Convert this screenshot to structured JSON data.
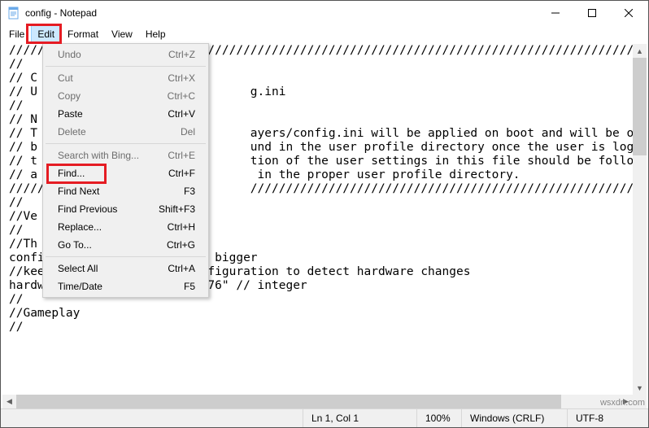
{
  "window": {
    "title": "config - Notepad",
    "min_icon": "minimize-icon",
    "max_icon": "maximize-icon",
    "close_icon": "close-icon"
  },
  "menubar": {
    "file": "File",
    "edit": "Edit",
    "format": "Format",
    "view": "View",
    "help": "Help"
  },
  "edit_menu": {
    "undo": {
      "label": "Undo",
      "shortcut": "Ctrl+Z"
    },
    "cut": {
      "label": "Cut",
      "shortcut": "Ctrl+X"
    },
    "copy": {
      "label": "Copy",
      "shortcut": "Ctrl+C"
    },
    "paste": {
      "label": "Paste",
      "shortcut": "Ctrl+V"
    },
    "delete": {
      "label": "Delete",
      "shortcut": "Del"
    },
    "bing": {
      "label": "Search with Bing...",
      "shortcut": "Ctrl+E"
    },
    "find": {
      "label": "Find...",
      "shortcut": "Ctrl+F"
    },
    "find_next": {
      "label": "Find Next",
      "shortcut": "F3"
    },
    "find_prev": {
      "label": "Find Previous",
      "shortcut": "Shift+F3"
    },
    "replace": {
      "label": "Replace...",
      "shortcut": "Ctrl+H"
    },
    "goto": {
      "label": "Go To...",
      "shortcut": "Ctrl+G"
    },
    "select_all": {
      "label": "Select All",
      "shortcut": "Ctrl+A"
    },
    "time_date": {
      "label": "Time/Date",
      "shortcut": "F5"
    }
  },
  "editor": {
    "lines": [
      "//////////////////////////////////////////////////////////////////////////////////////////////////",
      "//",
      "// C",
      "// U                              g.ini",
      "//",
      "// N",
      "// T                              ayers/config.ini will be applied on boot and will be overridden.",
      "// b                              und in the user profile directory once the user is logged in",
      "// t                              tion of the user settings in this file should be followed by",
      "// a                               in the proper user profile directory.",
      "///////                           ////////////////////////////////////////////////////////////////////",
      "",
      "//",
      "//Ve",
      "//",
      "//Th",
      "config_version = \"7\" // 0 or bigger",
      "",
      "//keep track of hardware configuration to detect hardware changes",
      "hardware_checksum = \"464945276\" // integer",
      "",
      "//",
      "//Gameplay",
      "//"
    ]
  },
  "status": {
    "position": "Ln 1, Col 1",
    "zoom": "100%",
    "line_ending": "Windows (CRLF)",
    "encoding": "UTF-8"
  },
  "watermark": "wsxdn.com"
}
